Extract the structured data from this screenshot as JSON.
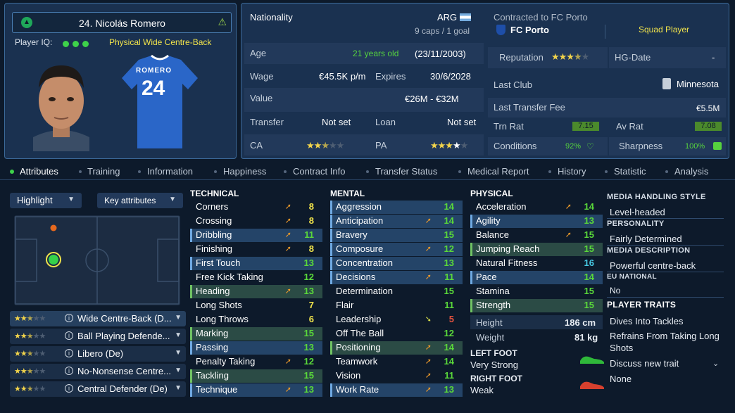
{
  "player": {
    "name": "24. Nicolás Romero",
    "iq_label": "Player IQ:",
    "role": "Physical Wide Centre-Back",
    "shirt_name": "ROMERO",
    "shirt_number": "24"
  },
  "details": {
    "nationality_label": "Nationality",
    "nationality": "ARG",
    "caps": "9 caps / 1 goal",
    "age_label": "Age",
    "age": "21 years old",
    "dob": "(23/11/2003)",
    "wage_label": "Wage",
    "wage": "€45.5K p/m",
    "expires_label": "Expires",
    "expires": "30/6/2028",
    "value_label": "Value",
    "value": "€26M - €32M",
    "transfer_label": "Transfer",
    "transfer": "Not set",
    "loan_label": "Loan",
    "loan": "Not set",
    "ca_label": "CA",
    "pa_label": "PA",
    "ca_stars": 2.5,
    "pa_stars": 4
  },
  "contract": {
    "contracted_to": "Contracted to FC Porto",
    "club": "FC Porto",
    "status": "Squad Player",
    "reputation_label": "Reputation",
    "reputation_stars": 3.5,
    "hg_label": "HG-Date",
    "hg_value": "-",
    "last_club_label": "Last Club",
    "last_club": "Minnesota",
    "last_fee_label": "Last Transfer Fee",
    "last_fee": "€5.5M",
    "trn_rat_label": "Trn Rat",
    "trn_rat": "7.15",
    "av_rat_label": "Av Rat",
    "av_rat": "7.08",
    "conditions_label": "Conditions",
    "conditions": "92%",
    "sharpness_label": "Sharpness",
    "sharpness": "100%"
  },
  "tabs": [
    "Attributes",
    "Training",
    "Information",
    "Happiness",
    "Contract Info",
    "Transfer Status",
    "Medical Report",
    "History",
    "Statistic",
    "Analysis"
  ],
  "controls": {
    "highlight": "Highlight",
    "key_attributes": "Key attributes"
  },
  "positions": [
    {
      "label": "Wide Centre-Back (D...",
      "stars": 2.5
    },
    {
      "label": "Ball Playing Defende...",
      "stars": 2.5
    },
    {
      "label": "Libero (De)",
      "stars": 2.5
    },
    {
      "label": "No-Nonsense Centre...",
      "stars": 2.5
    },
    {
      "label": "Central Defender (De)",
      "stars": 2.5
    }
  ],
  "technical": {
    "title": "TECHNICAL",
    "items": [
      {
        "name": "Corners",
        "value": "8",
        "color": "y",
        "arrow": "up",
        "hl": ""
      },
      {
        "name": "Crossing",
        "value": "8",
        "color": "y",
        "arrow": "up",
        "hl": ""
      },
      {
        "name": "Dribbling",
        "value": "11",
        "color": "g",
        "arrow": "up",
        "hl": "k"
      },
      {
        "name": "Finishing",
        "value": "8",
        "color": "y",
        "arrow": "up",
        "hl": ""
      },
      {
        "name": "First Touch",
        "value": "13",
        "color": "g",
        "arrow": "",
        "hl": "k"
      },
      {
        "name": "Free Kick Taking",
        "value": "12",
        "color": "g",
        "arrow": "",
        "hl": ""
      },
      {
        "name": "Heading",
        "value": "13",
        "color": "g",
        "arrow": "up",
        "hl": "g"
      },
      {
        "name": "Long Shots",
        "value": "7",
        "color": "y",
        "arrow": "",
        "hl": ""
      },
      {
        "name": "Long Throws",
        "value": "6",
        "color": "y",
        "arrow": "",
        "hl": ""
      },
      {
        "name": "Marking",
        "value": "15",
        "color": "g",
        "arrow": "",
        "hl": "g"
      },
      {
        "name": "Passing",
        "value": "13",
        "color": "g",
        "arrow": "",
        "hl": "k"
      },
      {
        "name": "Penalty Taking",
        "value": "12",
        "color": "g",
        "arrow": "up",
        "hl": ""
      },
      {
        "name": "Tackling",
        "value": "15",
        "color": "g",
        "arrow": "",
        "hl": "g"
      },
      {
        "name": "Technique",
        "value": "13",
        "color": "g",
        "arrow": "up",
        "hl": "k"
      }
    ]
  },
  "mental": {
    "title": "MENTAL",
    "items": [
      {
        "name": "Aggression",
        "value": "14",
        "color": "g",
        "arrow": "",
        "hl": "k"
      },
      {
        "name": "Anticipation",
        "value": "14",
        "color": "g",
        "arrow": "up",
        "hl": "k"
      },
      {
        "name": "Bravery",
        "value": "15",
        "color": "g",
        "arrow": "",
        "hl": "k"
      },
      {
        "name": "Composure",
        "value": "12",
        "color": "g",
        "arrow": "up",
        "hl": "k"
      },
      {
        "name": "Concentration",
        "value": "13",
        "color": "g",
        "arrow": "",
        "hl": "k"
      },
      {
        "name": "Decisions",
        "value": "11",
        "color": "g",
        "arrow": "up",
        "hl": "k"
      },
      {
        "name": "Determination",
        "value": "15",
        "color": "g",
        "arrow": "",
        "hl": ""
      },
      {
        "name": "Flair",
        "value": "11",
        "color": "g",
        "arrow": "",
        "hl": ""
      },
      {
        "name": "Leadership",
        "value": "5",
        "color": "r",
        "arrow": "down",
        "hl": ""
      },
      {
        "name": "Off The Ball",
        "value": "12",
        "color": "g",
        "arrow": "",
        "hl": ""
      },
      {
        "name": "Positioning",
        "value": "14",
        "color": "g",
        "arrow": "up",
        "hl": "g"
      },
      {
        "name": "Teamwork",
        "value": "14",
        "color": "g",
        "arrow": "up",
        "hl": ""
      },
      {
        "name": "Vision",
        "value": "11",
        "color": "g",
        "arrow": "up",
        "hl": ""
      },
      {
        "name": "Work Rate",
        "value": "13",
        "color": "g",
        "arrow": "up",
        "hl": "k"
      }
    ]
  },
  "physical": {
    "title": "PHYSICAL",
    "items": [
      {
        "name": "Acceleration",
        "value": "14",
        "color": "g",
        "arrow": "up",
        "hl": ""
      },
      {
        "name": "Agility",
        "value": "13",
        "color": "g",
        "arrow": "",
        "hl": "k"
      },
      {
        "name": "Balance",
        "value": "15",
        "color": "g",
        "arrow": "up",
        "hl": ""
      },
      {
        "name": "Jumping Reach",
        "value": "15",
        "color": "g",
        "arrow": "",
        "hl": "g"
      },
      {
        "name": "Natural Fitness",
        "value": "16",
        "color": "c",
        "arrow": "",
        "hl": ""
      },
      {
        "name": "Pace",
        "value": "14",
        "color": "g",
        "arrow": "",
        "hl": "k"
      },
      {
        "name": "Stamina",
        "value": "15",
        "color": "g",
        "arrow": "",
        "hl": ""
      },
      {
        "name": "Strength",
        "value": "15",
        "color": "g",
        "arrow": "",
        "hl": "g"
      }
    ],
    "height_label": "Height",
    "height": "186 cm",
    "weight_label": "Weight",
    "weight": "81 kg",
    "left_foot_label": "LEFT FOOT",
    "left_foot": "Very Strong",
    "right_foot_label": "RIGHT FOOT",
    "right_foot": "Weak"
  },
  "sidebar": {
    "media_style_label": "MEDIA HANDLING STYLE",
    "media_style": "Level-headed",
    "personality_label": "PERSONALITY",
    "personality": "Fairly Determined",
    "media_desc_label": "MEDIA DESCRIPTION",
    "media_desc": "Powerful centre-back",
    "eu_label": "EU NATIONAL",
    "eu": "No",
    "traits_label": "PLAYER TRAITS",
    "traits": [
      "Dives Into Tackles",
      "Refrains From Taking Long Shots"
    ],
    "discuss": "Discuss new trait",
    "none": "None"
  }
}
